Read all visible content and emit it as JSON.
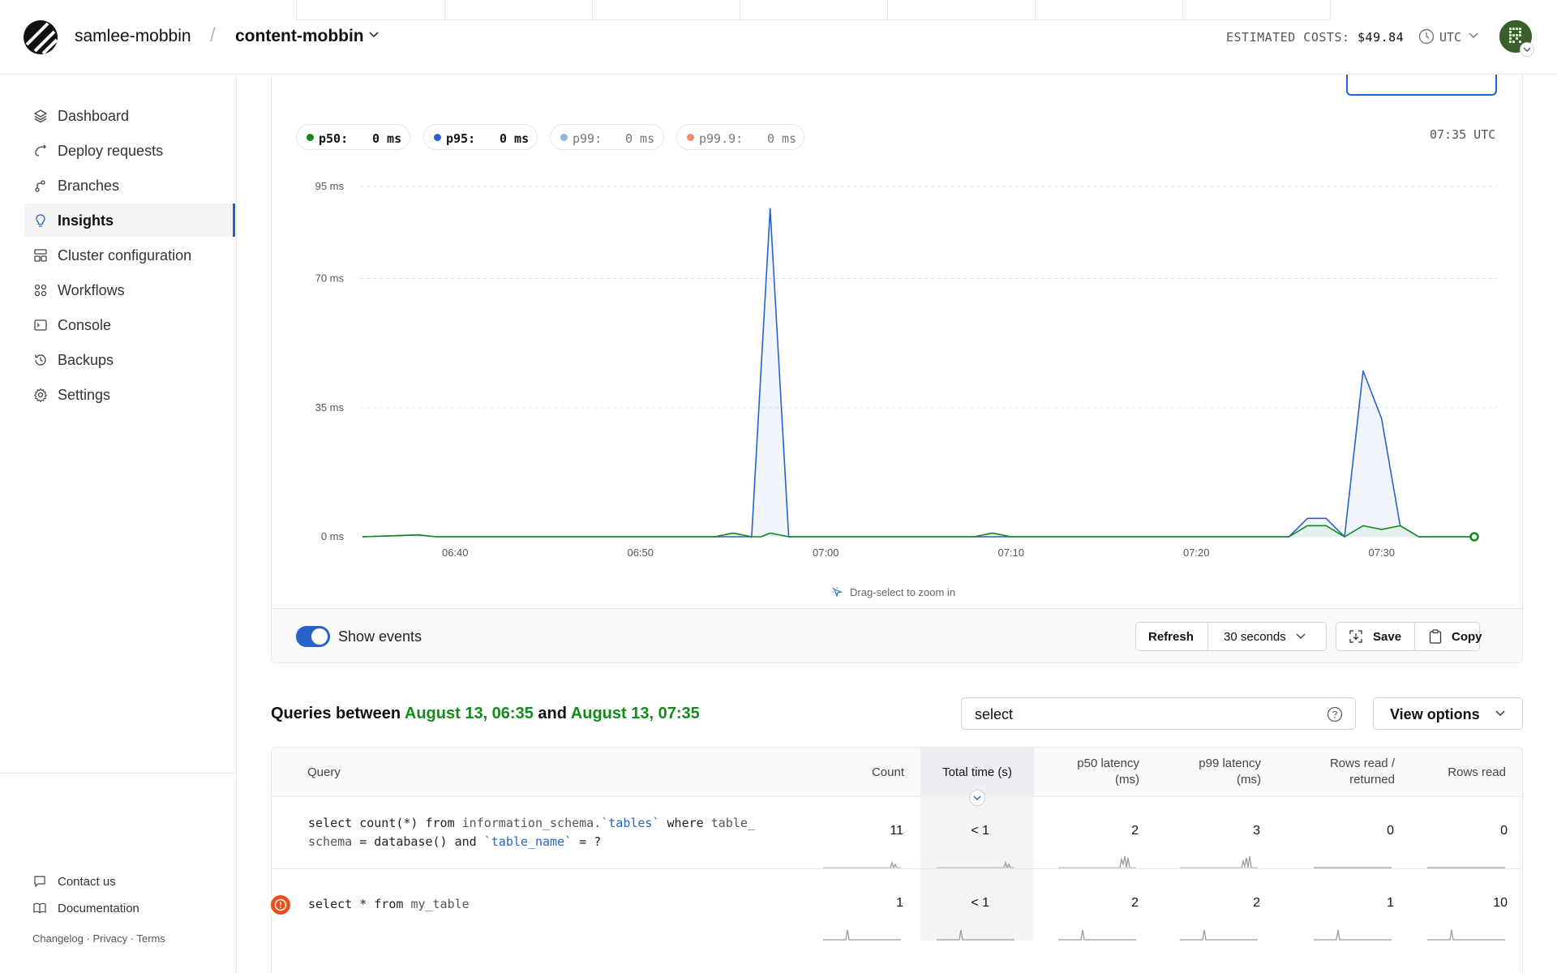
{
  "header": {
    "org": "samlee-mobbin",
    "separator": "/",
    "database": "content-mobbin",
    "costs_label": "ESTIMATED COSTS:",
    "costs_value": "$49.84",
    "timezone": "UTC"
  },
  "sidebar": {
    "items": [
      {
        "label": "Dashboard",
        "icon": "layers-icon"
      },
      {
        "label": "Deploy requests",
        "icon": "deploy-icon"
      },
      {
        "label": "Branches",
        "icon": "branch-icon"
      },
      {
        "label": "Insights",
        "icon": "lightbulb-icon",
        "active": true
      },
      {
        "label": "Cluster configuration",
        "icon": "cluster-icon"
      },
      {
        "label": "Workflows",
        "icon": "workflow-icon"
      },
      {
        "label": "Console",
        "icon": "console-icon"
      },
      {
        "label": "Backups",
        "icon": "backup-icon"
      },
      {
        "label": "Settings",
        "icon": "gear-icon"
      }
    ],
    "footer": {
      "contact": "Contact us",
      "docs": "Documentation",
      "changelog": "Changelog",
      "dot": "·",
      "privacy": "Privacy",
      "terms": "Terms"
    }
  },
  "legend": [
    {
      "label": "p50:",
      "value": "0 ms",
      "color": "#138a1b",
      "bold": true
    },
    {
      "label": "p95:",
      "value": "0 ms",
      "color": "#2563c9",
      "bold": true
    },
    {
      "label": "p99:",
      "value": "0 ms",
      "color": "#8fb4e6",
      "bold": false
    },
    {
      "label": "p99.9:",
      "value": "0 ms",
      "color": "#ee8a6a",
      "bold": false
    }
  ],
  "chart_time": "07:35 UTC",
  "chart_data": {
    "type": "line",
    "y_ticks": [
      "95 ms",
      "70 ms",
      "35 ms",
      "0 ms"
    ],
    "y_tick_values": [
      95,
      70,
      35,
      0
    ],
    "x_ticks": [
      "06:40",
      "06:50",
      "07:00",
      "07:10",
      "07:20",
      "07:30"
    ],
    "x_tick_minutes": [
      5,
      15,
      25,
      35,
      45,
      55
    ],
    "xlim": [
      0,
      60
    ],
    "ylim": [
      0,
      95
    ],
    "grid": true,
    "series": [
      {
        "name": "p95",
        "color": "#2563c9",
        "points": [
          [
            0,
            0
          ],
          [
            3,
            0.5
          ],
          [
            4,
            0
          ],
          [
            20,
            0
          ],
          [
            21,
            0
          ],
          [
            22,
            89
          ],
          [
            23,
            0
          ],
          [
            33,
            0
          ],
          [
            34,
            0
          ],
          [
            50,
            0
          ],
          [
            51,
            5
          ],
          [
            52,
            5
          ],
          [
            53,
            0
          ],
          [
            54,
            45
          ],
          [
            55,
            32
          ],
          [
            56,
            3
          ],
          [
            57,
            0
          ],
          [
            60,
            0
          ]
        ]
      },
      {
        "name": "p50",
        "color": "#138a1b",
        "points": [
          [
            0,
            0
          ],
          [
            3,
            0.5
          ],
          [
            4,
            0
          ],
          [
            19,
            0
          ],
          [
            20,
            1
          ],
          [
            21,
            0
          ],
          [
            21.5,
            0
          ],
          [
            22,
            1
          ],
          [
            23,
            0
          ],
          [
            33,
            0
          ],
          [
            34,
            1
          ],
          [
            35,
            0
          ],
          [
            50,
            0
          ],
          [
            51,
            3
          ],
          [
            52,
            3
          ],
          [
            53,
            0
          ],
          [
            54,
            3
          ],
          [
            55,
            2
          ],
          [
            56,
            3
          ],
          [
            57,
            0
          ],
          [
            60,
            0
          ]
        ]
      }
    ],
    "last_point": [
      60,
      0
    ]
  },
  "drag_hint": "Drag-select to zoom in",
  "events": {
    "toggle_label": "Show events",
    "refresh": "Refresh",
    "interval": "30 seconds",
    "save": "Save",
    "copy": "Copy"
  },
  "queries": {
    "title_prefix": "Queries between",
    "start": "August 13, 06:35",
    "and": "and",
    "end": "August 13, 07:35",
    "search_value": "select",
    "view_options": "View options",
    "columns": {
      "query": "Query",
      "count": "Count",
      "total_time": "Total time (s)",
      "p50_l1": "p50 latency",
      "p50_l2": "(ms)",
      "p99_l1": "p99 latency",
      "p99_l2": "(ms)",
      "rr_l1": "Rows read /",
      "rr_l2": "returned",
      "rows_read": "Rows read"
    },
    "rows": [
      {
        "q1_a": "select count(*) from ",
        "q1_b": "information_schema.",
        "q1_c": "`tables`",
        "q1_d": " where ",
        "q1_e": "table_",
        "q2_a": "schema",
        "q2_b": " = database() and ",
        "q2_c": "`table_name`",
        "q2_d": " = ?",
        "count": "11",
        "total": "< 1",
        "p50": "2",
        "p99": "3",
        "rr": "0",
        "rows_read": "0"
      },
      {
        "q_a": "select * from ",
        "q_b": "my_table",
        "count": "1",
        "total": "< 1",
        "p50": "2",
        "p99": "2",
        "rr": "1",
        "rows_read": "10"
      }
    ]
  }
}
